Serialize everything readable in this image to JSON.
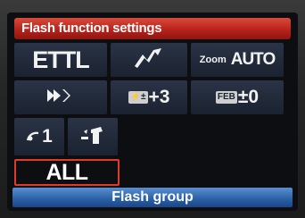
{
  "screen_title": "Flash function settings",
  "grid": {
    "flash_mode": "ETTL",
    "zoom_label": "Zoom",
    "zoom_value": "AUTO",
    "flash_comp_value": "+3",
    "feb_value": "±0",
    "channel_value": "1"
  },
  "selected_option": "ALL",
  "bottom_label": "Flash group",
  "icons": {
    "wireless_flash": "lightning-bolt-icon",
    "sync_mode": "high-speed-sync-icon",
    "flash_comp": "flash-exposure-compensation-icon",
    "feb": "feb-bracketing-icon",
    "channel": "wireless-channel-icon",
    "firing_group": "flash-firing-group-icon"
  },
  "icon_box_labels": {
    "flash_comp": "⚡±",
    "feb": "FEB"
  },
  "colors": {
    "title_bar": "#b8231b",
    "selection_border": "#e23a28",
    "bottom_bar": "#2c62a8",
    "cell_bg": "#1b2230"
  }
}
